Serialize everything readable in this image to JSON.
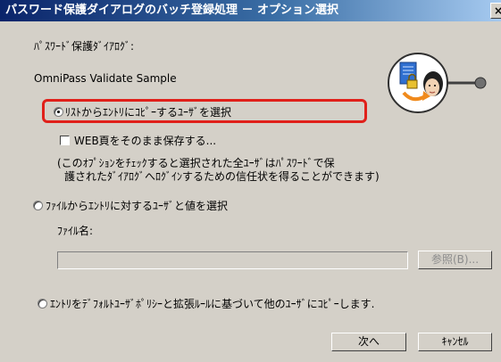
{
  "window": {
    "title": "パスワード保護ダイアログのバッチ登録処理 － オプション選択",
    "close_label": "×"
  },
  "dialog_info": {
    "label": "ﾊﾟｽﾜｰﾄﾞ保護ﾀﾞｲｱﾛｸﾞ:",
    "name": "OmniPass Validate Sample"
  },
  "options": {
    "copy_users": {
      "label": "ﾘｽﾄからｴﾝﾄﾘにｺﾋﾟｰするﾕｰｻﾞを選択",
      "selected": true
    },
    "save_web_page": {
      "label": "WEB頁をそのまま保存する...",
      "checked": false
    },
    "note_line1": "(このｵﾌﾟｼｮﾝをﾁｪｯｸすると選択された全ﾕｰｻﾞはﾊﾟｽﾜｰﾄﾞで保",
    "note_line2": "護されたﾀﾞｲｱﾛｸﾞへﾛｸﾞｲﾝするための信任状を得ることができます)",
    "file_select": {
      "label": "ﾌｧｲﾙからｴﾝﾄﾘに対するﾕｰｻﾞと値を選択",
      "selected": false
    },
    "file_name_label": "ﾌｧｲﾙ名:",
    "file_name_value": "",
    "browse_label": "参照(B)...",
    "default_policy": {
      "label": "ｴﾝﾄﾘをﾃﾞﾌｫﾙﾄﾕｰｻﾞﾎﾟﾘｼｰと拡張ﾙｰﾙに基づいて他のﾕｰｻﾞにｺﾋﾟｰします.",
      "selected": false
    }
  },
  "buttons": {
    "next_label": "次へ",
    "cancel_label": "ｷｬﾝｾﾙ"
  },
  "colors": {
    "highlight": "#e0201a",
    "title_bar": "#0a246a"
  },
  "icons": [
    "document-lock-icon",
    "user-face-icon"
  ]
}
